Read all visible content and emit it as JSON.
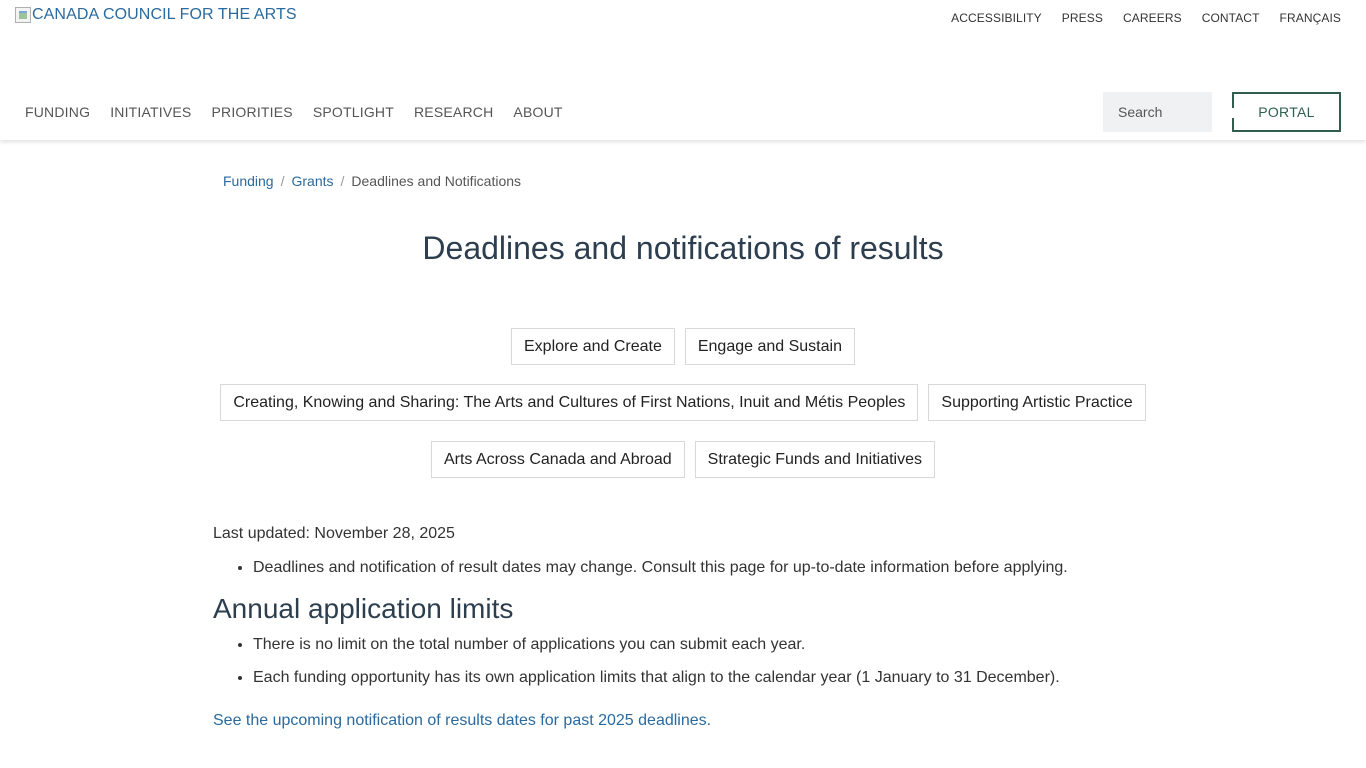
{
  "header": {
    "logo_alt": "CANADA COUNCIL FOR THE ARTS",
    "utility_nav": [
      "ACCESSIBILITY",
      "PRESS",
      "CAREERS",
      "CONTACT",
      "FRANÇAIS"
    ],
    "main_nav": [
      "FUNDING",
      "INITIATIVES",
      "PRIORITIES",
      "SPOTLIGHT",
      "RESEARCH",
      "ABOUT"
    ],
    "search_placeholder": "Search",
    "portal_label": "PORTAL"
  },
  "breadcrumb": [
    "Funding",
    "Grants",
    "Deadlines and Notifications"
  ],
  "page_title": "Deadlines and notifications of results",
  "program_links": [
    [
      "Explore and Create",
      "Engage and Sustain"
    ],
    [
      "Creating, Knowing and Sharing: The Arts and Cultures of First Nations, Inuit and Métis Peoples",
      "Supporting Artistic Practice"
    ],
    [
      "Arts Across Canada and Abroad",
      "Strategic Funds and Initiatives"
    ]
  ],
  "content": {
    "last_updated": "Last updated: November 28, 2025",
    "notice": "Deadlines and notification of result dates may change. Consult this page for up-to-date information before applying.",
    "limits_heading": "Annual application limits",
    "limits": [
      "There is no limit on the total number of applications you can submit each year.",
      "Each funding opportunity has its own application limits that align to the calendar year (1 January to 31 December)."
    ],
    "results_link": "See the upcoming notification of results dates for past 2025 deadlines."
  },
  "colors": {
    "link": "#2a6a9e",
    "heading": "#2d3e4e",
    "portal_border": "#2f5f4c",
    "search_bg": "#f0f1f2"
  }
}
